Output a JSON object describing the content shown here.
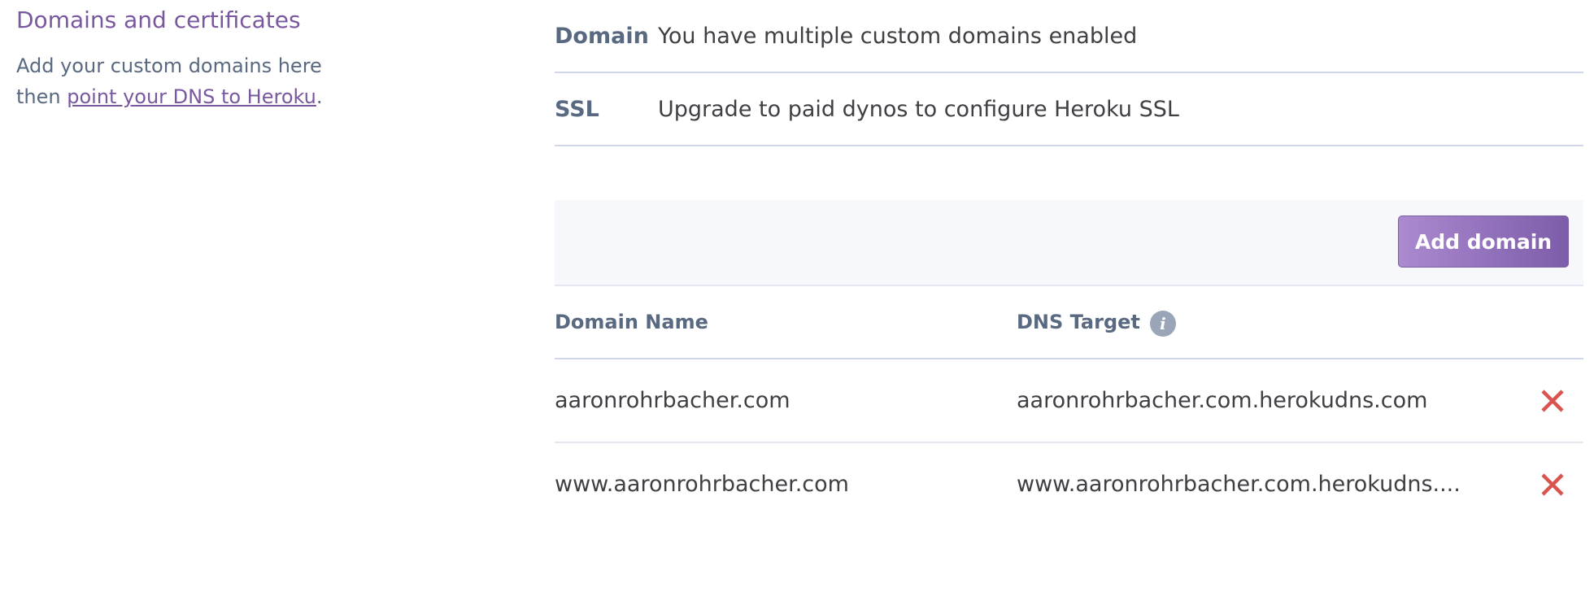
{
  "section": {
    "title": "Domains and certificates",
    "desc_prefix": "Add your custom domains here then ",
    "desc_link": "point your DNS to Heroku",
    "desc_suffix": "."
  },
  "info_rows": [
    {
      "label": "Domain",
      "value": "You have multiple custom domains enabled"
    },
    {
      "label": "SSL",
      "value": "Upgrade to paid dynos to configure Heroku SSL"
    }
  ],
  "toolbar": {
    "add_label": "Add domain"
  },
  "table": {
    "headers": {
      "name": "Domain Name",
      "target": "DNS Target"
    },
    "info_icon": "info-icon",
    "remove_icon": "close-icon",
    "remove_color": "#d9534f",
    "rows": [
      {
        "name": "aaronrohrbacher.com",
        "target": "aaronrohrbacher.com.herokudns.com"
      },
      {
        "name": "www.aaronrohrbacher.com",
        "target": "www.aaronrohrbacher.com.herokudns...."
      }
    ]
  },
  "colors": {
    "accent": "#79589f",
    "label": "#596981",
    "text": "#3f3f44",
    "border": "#cfd7e6"
  }
}
